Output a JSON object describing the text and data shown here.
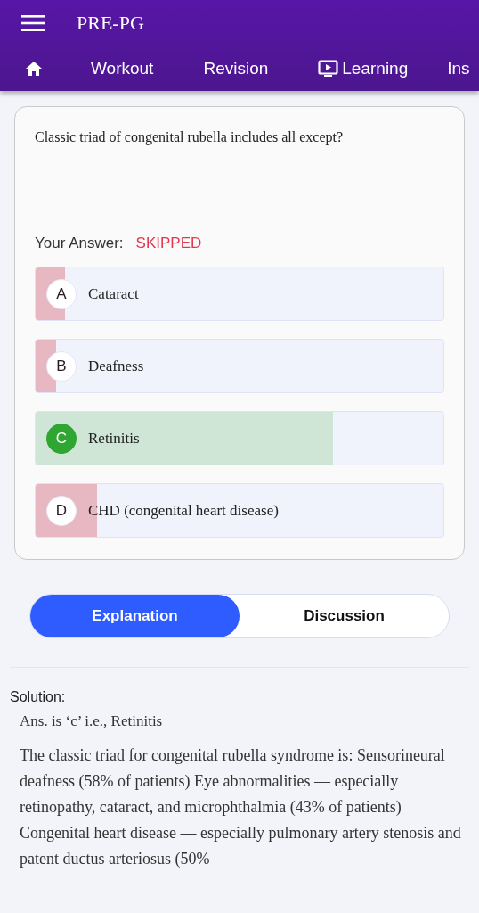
{
  "app_bar": {
    "title": "PRE-PG"
  },
  "nav_tabs": [
    {
      "kind": "home"
    },
    {
      "kind": "text",
      "label": "Workout"
    },
    {
      "kind": "text",
      "label": "Revision"
    },
    {
      "kind": "video",
      "label": "Learning"
    },
    {
      "kind": "text",
      "label": "Ins"
    }
  ],
  "question": {
    "text": "Classic triad of congenital rubella includes all except?",
    "answer_label": "Your Answer:",
    "answer_value": "SKIPPED",
    "options": [
      {
        "letter": "A",
        "text": "Cataract",
        "kind": "wrong",
        "level": 0.072
      },
      {
        "letter": "B",
        "text": "Deafness",
        "kind": "wrong",
        "level": 0.05
      },
      {
        "letter": "C",
        "text": "Retinitis",
        "kind": "correct",
        "level": 0.73
      },
      {
        "letter": "D",
        "text": "CHD (congenital heart disease)",
        "kind": "wrong",
        "level": 0.151
      }
    ]
  },
  "segments": [
    {
      "label": "Explanation",
      "selected": true
    },
    {
      "label": "Discussion",
      "selected": false
    }
  ],
  "solution": {
    "heading": "Solution:",
    "answer": "Ans. is ‘c’ i.e., Retinitis",
    "paragraph": "The classic triad for congenital rubella syndrome is: Sensorineural deafness (58% of patients) Eye abnormalities — especially retinopathy, cataract, and microphthalmia (43% of patients) Congenital heart disease — especially pulmonary artery stenosis and patent ductus arteriosus (50%"
  }
}
